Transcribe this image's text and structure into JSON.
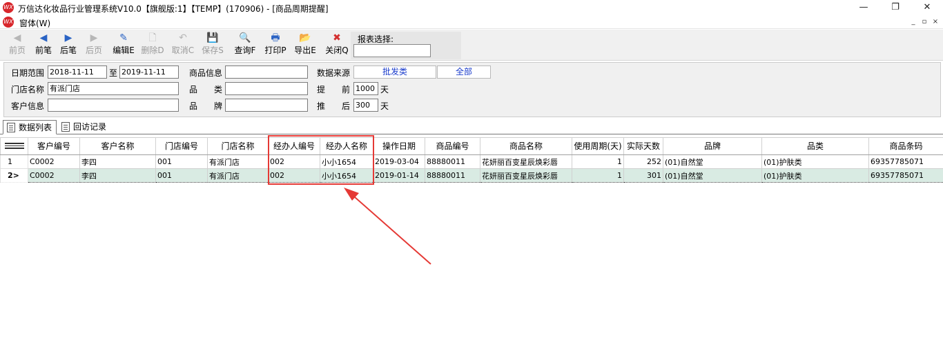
{
  "window": {
    "title": "万信达化妆品行业管理系统V10.0【旗舰版:1】【TEMP】(170906) - [商品周期提醒]",
    "logo_text": "WX",
    "minimize": "—",
    "maximize": "❐",
    "close": "✕"
  },
  "menubar": {
    "menu_label": "窗体(W)",
    "mdi_min": "_",
    "mdi_restore": "▫",
    "mdi_close": "×"
  },
  "toolbar": {
    "buttons": [
      {
        "label": "前页",
        "icon": "first-page-icon",
        "glyph": "◀",
        "enabled": false
      },
      {
        "label": "前笔",
        "icon": "prev-record-icon",
        "glyph": "◀",
        "enabled": true
      },
      {
        "label": "后笔",
        "icon": "next-record-icon",
        "glyph": "▶",
        "enabled": true
      },
      {
        "label": "后页",
        "icon": "last-page-icon",
        "glyph": "▶",
        "enabled": false
      },
      {
        "label": "编辑E",
        "icon": "edit-icon",
        "glyph": "✎",
        "enabled": true
      },
      {
        "label": "删除D",
        "icon": "delete-icon",
        "glyph": "🗋",
        "enabled": false
      },
      {
        "label": "取消C",
        "icon": "undo-icon",
        "glyph": "↶",
        "enabled": false
      },
      {
        "label": "保存S",
        "icon": "save-icon",
        "glyph": "💾",
        "enabled": false
      },
      {
        "label": "查询F",
        "icon": "query-icon",
        "glyph": "🔍",
        "enabled": true
      },
      {
        "label": "打印P",
        "icon": "print-icon",
        "glyph": "🖶",
        "enabled": true
      },
      {
        "label": "导出E",
        "icon": "export-icon",
        "glyph": "📂",
        "enabled": true
      },
      {
        "label": "关闭Q",
        "icon": "close-icon",
        "glyph": "✖",
        "enabled": true
      }
    ],
    "report_label": "报表选择:",
    "report_value": ""
  },
  "filter": {
    "date_range_label": "日期范围",
    "date_from": "2018-11-11",
    "to_label": "至",
    "date_to": "2019-11-11",
    "product_info_label": "商品信息",
    "product_info_value": "",
    "data_source_label": "数据来源",
    "data_source_option1": "批发类",
    "data_source_option2": "全部",
    "store_name_label": "门店名称",
    "store_name_value": "有派门店",
    "category_label": "品　　类",
    "category_value": "",
    "advance_label": "提　　前",
    "advance_value": "1000",
    "advance_unit": "天",
    "customer_info_label": "客户信息",
    "customer_info_value": "",
    "brand_label": "品　　牌",
    "brand_value": "",
    "delay_label": "推　　后",
    "delay_value": "300",
    "delay_unit": "天"
  },
  "tabs": [
    {
      "label": "数据列表",
      "active": true
    },
    {
      "label": "回访记录",
      "active": false
    }
  ],
  "grid": {
    "columns": [
      "",
      "客户编号",
      "客户名称",
      "门店编号",
      "门店名称",
      "经办人编号",
      "经办人名称",
      "操作日期",
      "商品编号",
      "商品名称",
      "使用周期(天)",
      "实际天数",
      "品牌",
      "品类",
      "商品条码"
    ],
    "rows": [
      {
        "indicator": "1",
        "cells": [
          "C0002",
          "李四",
          "001",
          "有派门店",
          "002",
          "小小1654",
          "2019-03-04",
          "88880011",
          "花妍丽百变星辰焕彩唇",
          "1",
          "252",
          "(01)自然堂",
          "(01)护肤类",
          "69357785071"
        ]
      },
      {
        "indicator": "2>",
        "cells": [
          "C0002",
          "李四",
          "001",
          "有派门店",
          "002",
          "小小1654",
          "2019-01-14",
          "88880011",
          "花妍丽百变星辰焕彩唇",
          "1",
          "301",
          "(01)自然堂",
          "(01)护肤类",
          "69357785071"
        ]
      }
    ],
    "selected_row": 1
  },
  "colors": {
    "highlight": "#e53935",
    "selected_row": "#d9ebe3",
    "toolbar_bg": "#f0f0f0",
    "link_blue": "#1a3ccc"
  }
}
